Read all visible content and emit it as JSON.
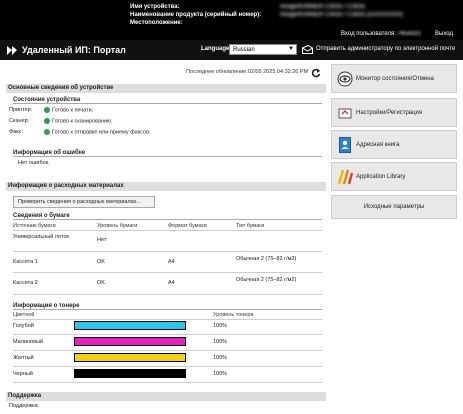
{
  "header": {
    "device_name_label": "Имя устройства:",
    "device_name_value": "imageRUNNER C3025 / C3025",
    "product_name_label": "Наименование продукта (серийный номер):",
    "product_name_value": "imageRUNNER C3025 / C3025 (XXXXXXXX)",
    "location_label": "Местоположение:",
    "login_label": "Вход пользователя:",
    "login_user": "7654321",
    "logout_label": "Выход",
    "portal_title": "Удаленный ИП: Портал",
    "language_label": "Language:",
    "language_value": "Russian",
    "mail_link": "Отправить администратору по электронной почте"
  },
  "main": {
    "updated": "Последнее обновление:02/05 2025 04:32:26 PM",
    "basic_info": {
      "title": "Основные сведения об устройстве",
      "status_title": "Состояние устройства",
      "rows": [
        {
          "label": "Принтер:",
          "value": "Готово к печати."
        },
        {
          "label": "Сканер:",
          "value": "Готово к сканированию."
        },
        {
          "label": "Факс:",
          "value": "Готово к отправке или приему факсов."
        }
      ],
      "error_title": "Информация об ошибке",
      "error_value": "Нет ошибок."
    },
    "consumables": {
      "title": "Информация о расходных материалах",
      "check_button": "Проверить сведения о расходных материалах...",
      "paper_title": "Сведения о бумаге",
      "paper_headers": [
        "Источник бумаги",
        "Уровень бумаги",
        "Формат бумаги",
        "Тип бумаги"
      ],
      "paper_rows": [
        {
          "source": "Универсальный лоток",
          "level": "Нет",
          "size": "",
          "type": ""
        },
        {
          "source": "Кассета 1",
          "level": "OK",
          "size": "A4",
          "type": "Обычная 2 (75–82 г/м2)"
        },
        {
          "source": "Кассета 2",
          "level": "OK",
          "size": "A4",
          "type": "Обычная 2 (75–82 г/м2)"
        }
      ],
      "toner_title": "Информация о тонере",
      "toner_headers": [
        "Цветной",
        "Уровень тонера"
      ],
      "toner_rows": [
        {
          "name": "Голубой",
          "level": "100%",
          "color": "#29c6ee"
        },
        {
          "name": "Малиновый",
          "level": "100%",
          "color": "#e51fc4"
        },
        {
          "name": "Желтый",
          "level": "100%",
          "color": "#f7d200"
        },
        {
          "name": "Черный",
          "level": "100%",
          "color": "#000000"
        }
      ]
    },
    "support": {
      "title": "Поддержка",
      "label": "Поддержка:"
    }
  },
  "sidebar": {
    "items": [
      {
        "label": "Монитор состояния/Отмена",
        "icon": "status-monitor-icon"
      },
      {
        "label": "Настройки/Регистрация",
        "icon": "settings-icon"
      },
      {
        "label": "Адресная книга",
        "icon": "address-book-icon"
      },
      {
        "label": "Application Library",
        "icon": "app-library-icon"
      },
      {
        "label": "Исходные параметры",
        "icon": ""
      }
    ]
  }
}
